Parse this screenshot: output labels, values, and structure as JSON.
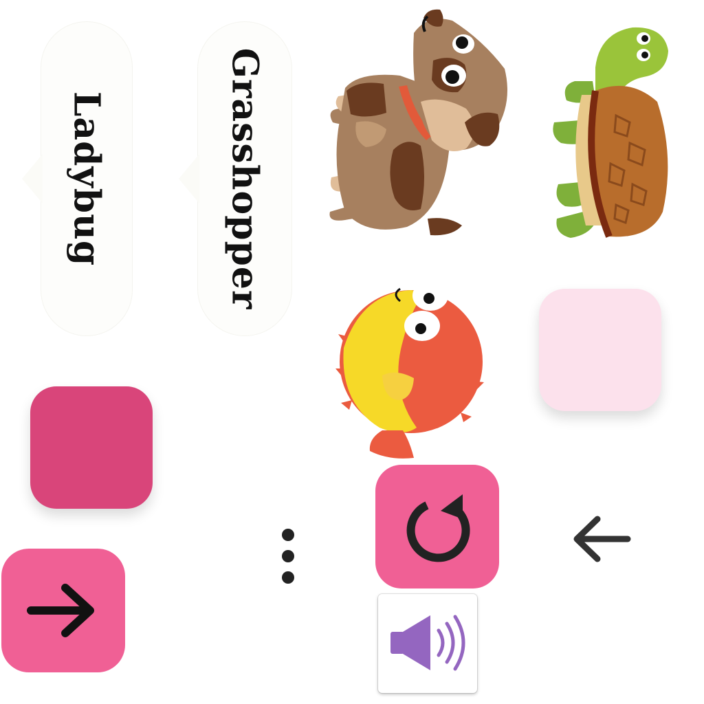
{
  "words": [
    {
      "label": "Ladybug"
    },
    {
      "label": "Grasshopper"
    }
  ],
  "animals": [
    {
      "name": "dog",
      "icon": "dog-illustration"
    },
    {
      "name": "turtle",
      "icon": "turtle-illustration"
    },
    {
      "name": "pufferfish",
      "icon": "pufferfish-illustration"
    }
  ],
  "tiles": {
    "light_color": "#fce1ec",
    "dark_color": "#d9457a"
  },
  "controls": {
    "next": {
      "icon": "arrow-right-icon",
      "color": "#f06095"
    },
    "replay": {
      "icon": "replay-icon",
      "color": "#f06095"
    },
    "back": {
      "icon": "arrow-left-icon"
    },
    "more": {
      "icon": "more-vertical-icon"
    },
    "sound": {
      "icon": "speaker-icon",
      "color": "#9466c0"
    }
  }
}
